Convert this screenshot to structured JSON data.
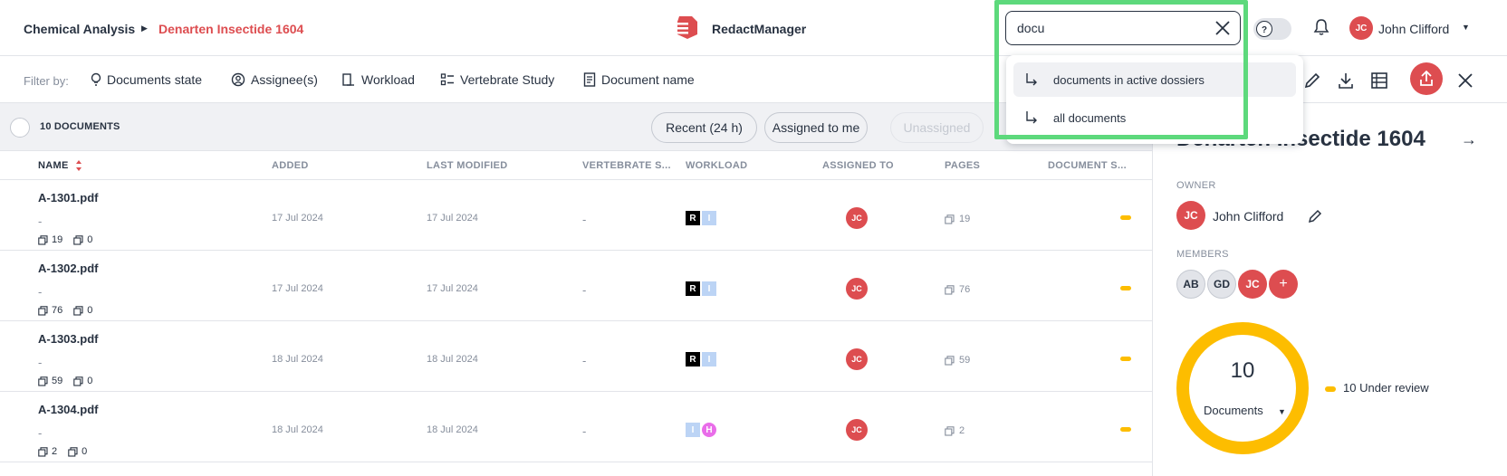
{
  "header": {
    "breadcrumb_root": "Chemical Analysis",
    "breadcrumb_separator": "▶",
    "breadcrumb_current": "Denarten Insectide 1604",
    "app_name": "RedactManager",
    "search_value": "docu",
    "user_initials": "JC",
    "user_name": "John Clifford",
    "user_caret": "▼"
  },
  "search_suggestions": [
    {
      "label": "documents in active dossiers",
      "active": true
    },
    {
      "label": "all documents",
      "active": false
    }
  ],
  "filters": {
    "label": "Filter by:",
    "items": [
      "Documents state",
      "Assignee(s)",
      "Workload",
      "Vertebrate Study",
      "Document name"
    ]
  },
  "list": {
    "count_label": "10 DOCUMENTS",
    "quick_filters": [
      "Recent (24 h)",
      "Assigned to me",
      "Unassigned"
    ],
    "columns": [
      "NAME",
      "ADDED",
      "LAST MODIFIED",
      "VERTEBRATE S...",
      "WORKLOAD",
      "ASSIGNED TO",
      "PAGES",
      "DOCUMENT S..."
    ],
    "rows": [
      {
        "name": "A-1301.pdf",
        "sub": "-",
        "pages_stat": "19",
        "annot_stat": "0",
        "added": "17 Jul 2024",
        "modified": "17 Jul 2024",
        "vertebrate": "-",
        "workload": [
          "R",
          "I"
        ],
        "assignee": "JC",
        "pages": "19"
      },
      {
        "name": "A-1302.pdf",
        "sub": "-",
        "pages_stat": "76",
        "annot_stat": "0",
        "added": "17 Jul 2024",
        "modified": "17 Jul 2024",
        "vertebrate": "-",
        "workload": [
          "R",
          "I"
        ],
        "assignee": "JC",
        "pages": "76"
      },
      {
        "name": "A-1303.pdf",
        "sub": "-",
        "pages_stat": "59",
        "annot_stat": "0",
        "added": "18 Jul 2024",
        "modified": "18 Jul 2024",
        "vertebrate": "-",
        "workload": [
          "R",
          "I"
        ],
        "assignee": "JC",
        "pages": "59"
      },
      {
        "name": "A-1304.pdf",
        "sub": "-",
        "pages_stat": "2",
        "annot_stat": "0",
        "added": "18 Jul 2024",
        "modified": "18 Jul 2024",
        "vertebrate": "-",
        "workload": [
          "I",
          "H"
        ],
        "assignee": "JC",
        "pages": "2"
      }
    ]
  },
  "panel": {
    "title": "Denarten Insectide 1604",
    "arrow": "→",
    "owner_label": "OWNER",
    "owner_initials": "JC",
    "owner_name": "John Clifford",
    "members_label": "MEMBERS",
    "members": [
      "AB",
      "GD",
      "JC",
      "+"
    ],
    "chart_total": "10",
    "chart_label": "Documents",
    "chart_caret": "▼",
    "legend": "10 Under review"
  },
  "colors": {
    "accent": "#dd4d50",
    "under_review": "#fdbd00",
    "highlight": "#5dd97c"
  }
}
